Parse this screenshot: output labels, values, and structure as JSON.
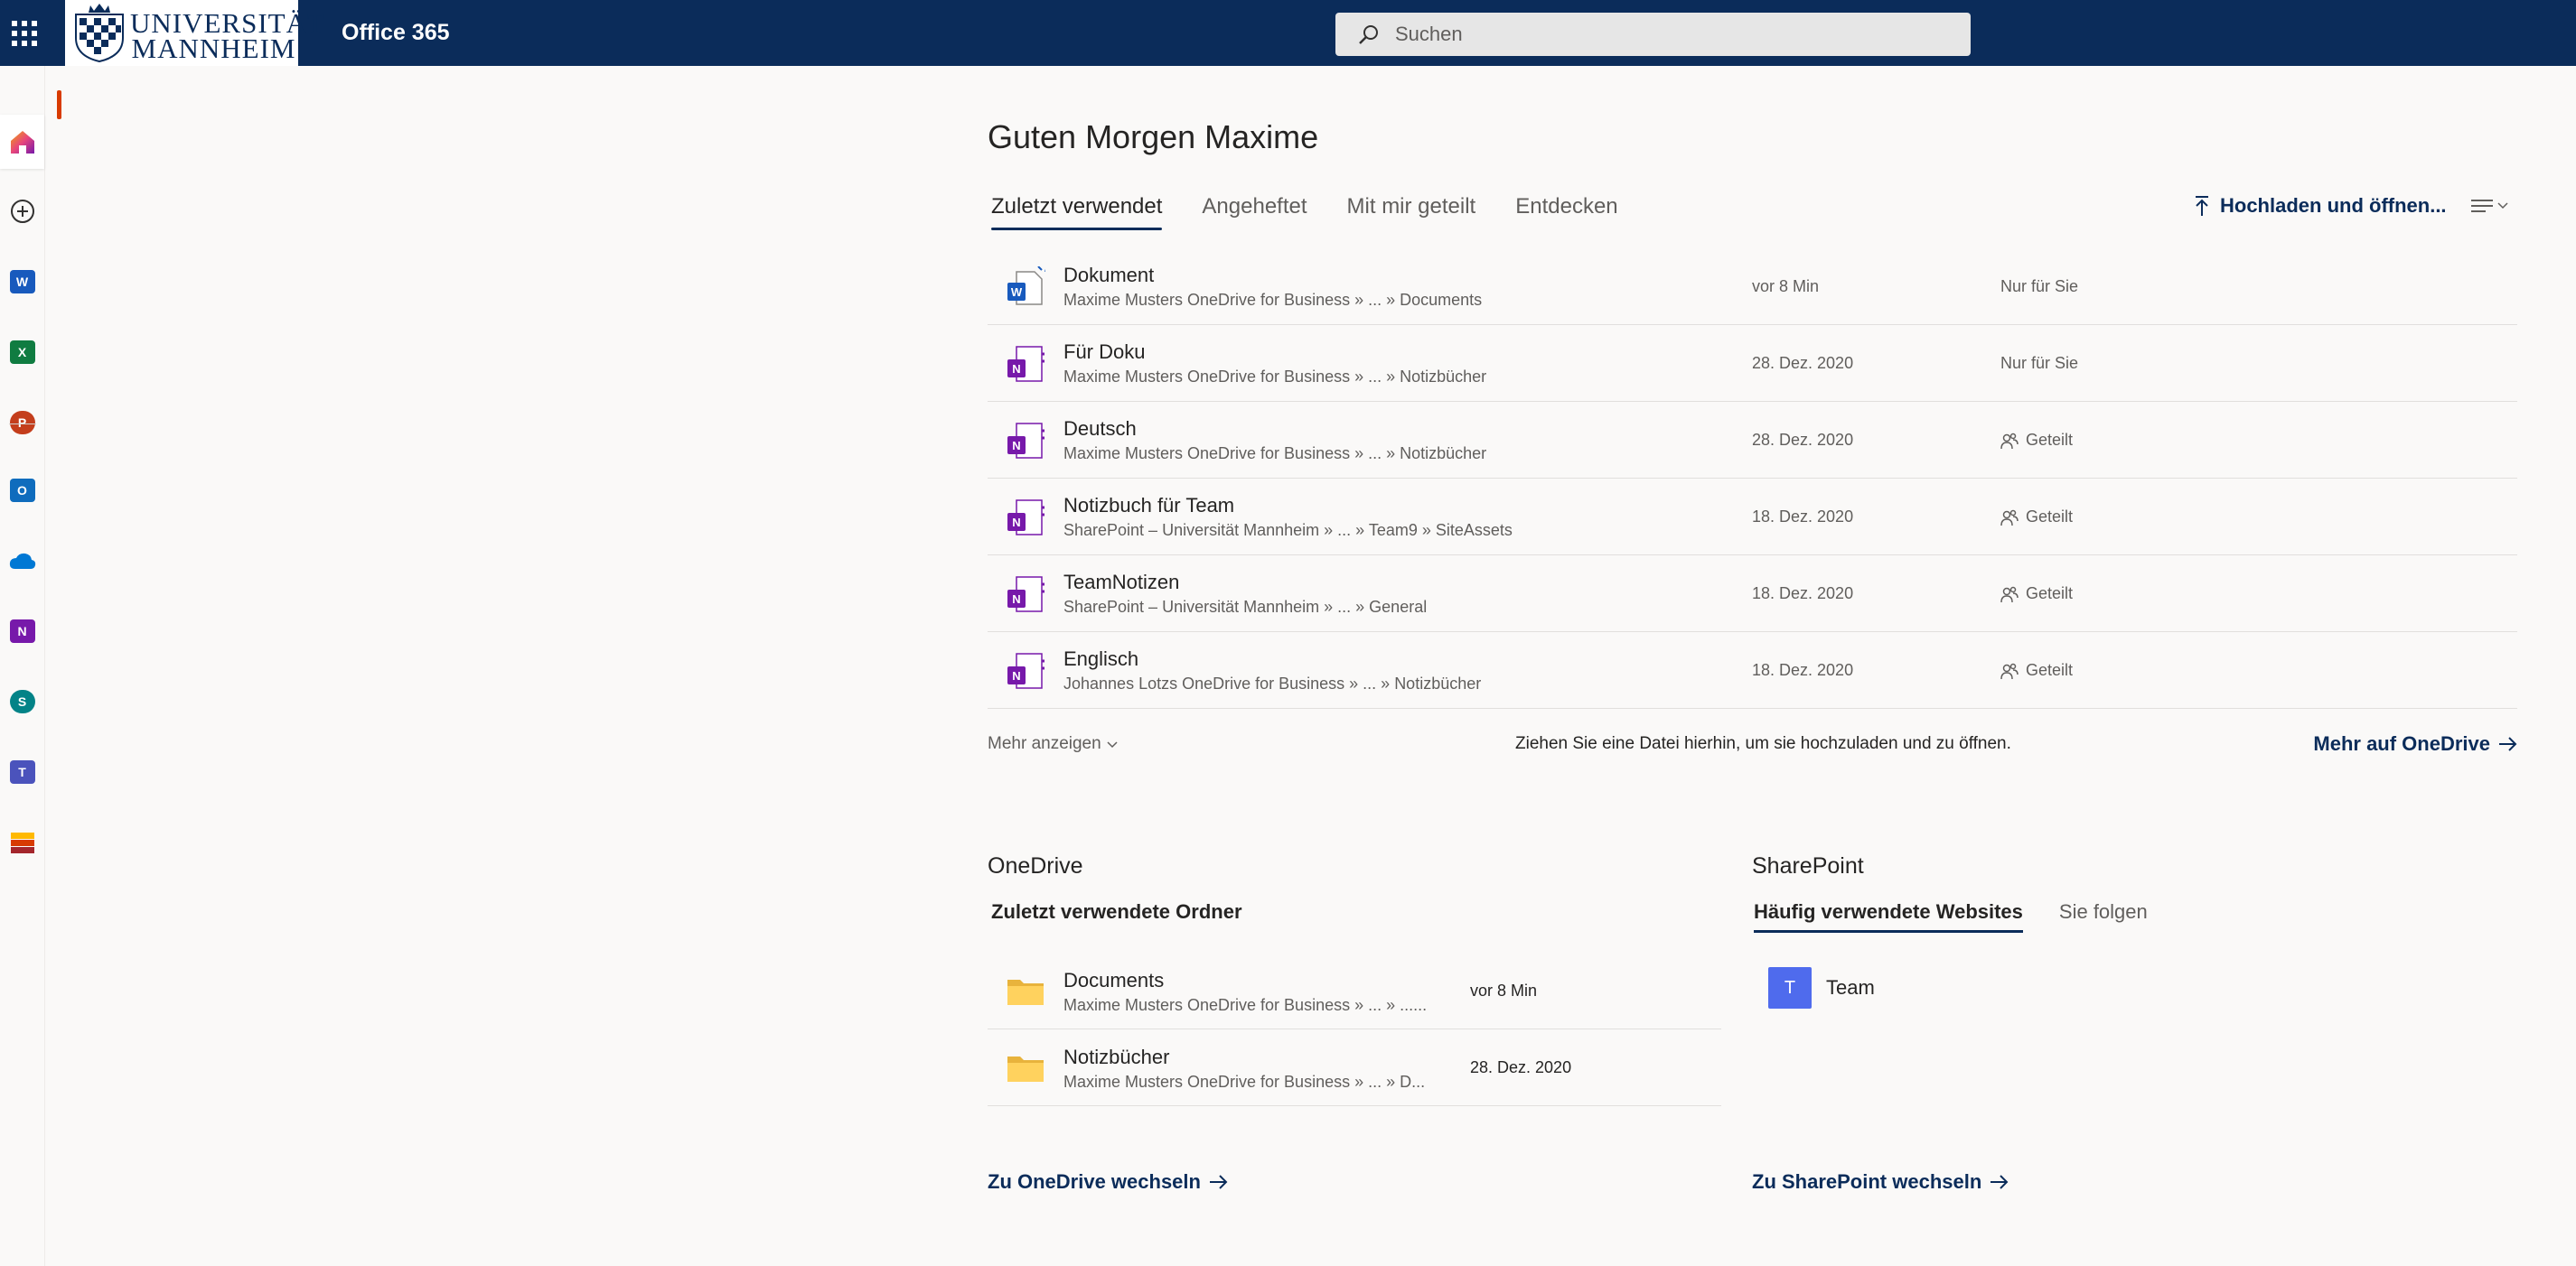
{
  "header": {
    "logo_text_line1": "UNIVERSITÄT",
    "logo_text_line2": "MANNHEIM",
    "app_name": "Office 365",
    "search_placeholder": "Suchen"
  },
  "rail": {
    "items": [
      {
        "name": "home",
        "letter": ""
      },
      {
        "name": "create",
        "letter": ""
      },
      {
        "name": "word",
        "letter": "W",
        "color": "#185abd"
      },
      {
        "name": "excel",
        "letter": "X",
        "color": "#107c41"
      },
      {
        "name": "powerpoint",
        "letter": "P",
        "color": "#c43e1c"
      },
      {
        "name": "outlook",
        "letter": "O",
        "color": "#0f6cbd"
      },
      {
        "name": "onedrive",
        "letter": "",
        "color": "#0078d4"
      },
      {
        "name": "onenote",
        "letter": "N",
        "color": "#7719aa"
      },
      {
        "name": "sharepoint",
        "letter": "S",
        "color": "#038387"
      },
      {
        "name": "teams",
        "letter": "T",
        "color": "#4b53bc"
      },
      {
        "name": "all-apps",
        "letter": "",
        "color": "#d83b01"
      }
    ]
  },
  "main": {
    "greeting": "Guten Morgen Maxime",
    "tabs": [
      "Zuletzt verwendet",
      "Angeheftet",
      "Mit mir geteilt",
      "Entdecken"
    ],
    "upload_label": "Hochladen und öffnen...",
    "files": [
      {
        "name": "Dokument",
        "path": "Maxime Musters OneDrive for Business » ... » Documents",
        "date": "vor 8 Min",
        "share": "Nur für Sie",
        "type": "word"
      },
      {
        "name": "Für Doku",
        "path": "Maxime Musters OneDrive for Business » ... » Notizbücher",
        "date": "28. Dez. 2020",
        "share": "Nur für Sie",
        "type": "onenote"
      },
      {
        "name": "Deutsch",
        "path": "Maxime Musters OneDrive for Business » ... » Notizbücher",
        "date": "28. Dez. 2020",
        "share": "Geteilt",
        "type": "onenote"
      },
      {
        "name": "Notizbuch für Team",
        "path": "SharePoint – Universität Mannheim » ... » Team9 » SiteAssets",
        "date": "18. Dez. 2020",
        "share": "Geteilt",
        "type": "onenote"
      },
      {
        "name": "TeamNotizen",
        "path": "SharePoint – Universität Mannheim » ... » General",
        "date": "18. Dez. 2020",
        "share": "Geteilt",
        "type": "onenote"
      },
      {
        "name": "Englisch",
        "path": "Johannes Lotzs OneDrive for Business » ... » Notizbücher",
        "date": "18. Dez. 2020",
        "share": "Geteilt",
        "type": "onenote"
      }
    ],
    "more_label": "Mehr anzeigen",
    "drop_text": "Ziehen Sie eine Datei hierhin, um sie hochzuladen und zu öffnen.",
    "onedrive_more": "Mehr auf OneDrive"
  },
  "onedrive": {
    "title": "OneDrive",
    "subtitle": "Zuletzt verwendete Ordner",
    "folders": [
      {
        "name": "Documents",
        "path": "Maxime Musters OneDrive for Business » ... » ......",
        "date": "vor 8 Min"
      },
      {
        "name": "Notizbücher",
        "path": "Maxime Musters OneDrive for Business » ... » D...",
        "date": "28. Dez. 2020"
      }
    ],
    "link": "Zu OneDrive wechseln"
  },
  "sharepoint": {
    "title": "SharePoint",
    "tabs": [
      "Häufig verwendete Websites",
      "Sie folgen"
    ],
    "sites": [
      {
        "initial": "T",
        "name": "Team",
        "color": "#4f6bed"
      }
    ],
    "link": "Zu SharePoint wechseln"
  }
}
